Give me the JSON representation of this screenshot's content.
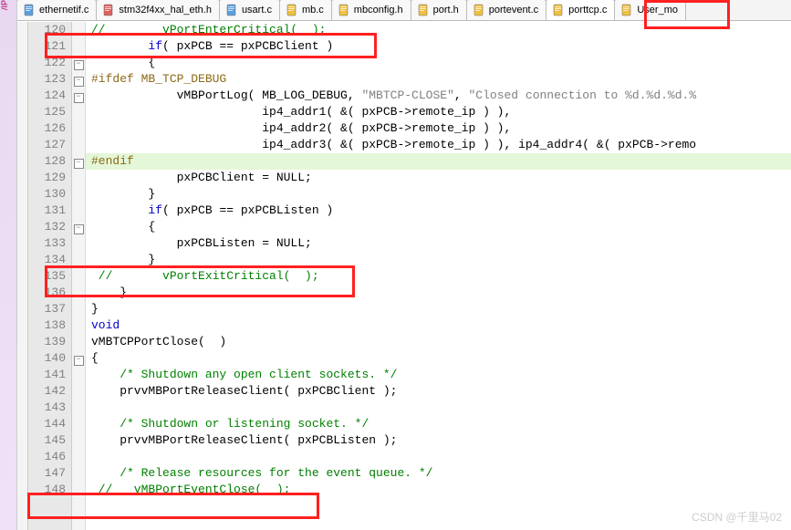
{
  "leftStrip": {
    "label": "/IP"
  },
  "tabs": [
    {
      "label": "ethernetif.c",
      "color": "#5aa0e0",
      "active": false
    },
    {
      "label": "stm32f4xx_hal_eth.h",
      "color": "#e06060",
      "active": false
    },
    {
      "label": "usart.c",
      "color": "#5aa0e0",
      "active": false
    },
    {
      "label": "mb.c",
      "color": "#f0c040",
      "active": false
    },
    {
      "label": "mbconfig.h",
      "color": "#f0c040",
      "active": false
    },
    {
      "label": "port.h",
      "color": "#f0c040",
      "active": false
    },
    {
      "label": "portevent.c",
      "color": "#f0c040",
      "active": false
    },
    {
      "label": "porttcp.c",
      "color": "#f0c040",
      "active": true
    },
    {
      "label": "User_mo",
      "color": "#f0c040",
      "active": false
    }
  ],
  "code": {
    "start": 120,
    "lines": [
      {
        "fold": "",
        "spans": [
          [
            "c-comment",
            "//        vPortEnterCritical(  );"
          ]
        ]
      },
      {
        "fold": "",
        "spans": [
          [
            "c-ident",
            "        "
          ],
          [
            "c-kw",
            "if"
          ],
          [
            "c-ident",
            "( pxPCB == pxPCBClient )"
          ]
        ]
      },
      {
        "fold": "-",
        "spans": [
          [
            "c-ident",
            "        {"
          ]
        ]
      },
      {
        "fold": "-",
        "spans": [
          [
            "c-pre",
            "#ifdef MB_TCP_DEBUG"
          ]
        ]
      },
      {
        "fold": "-",
        "spans": [
          [
            "c-ident",
            "            vMBPortLog( MB_LOG_DEBUG, "
          ],
          [
            "c-str",
            "\"MBTCP-CLOSE\""
          ],
          [
            "c-ident",
            ", "
          ],
          [
            "c-str",
            "\"Closed connection to %d.%d.%d.%"
          ]
        ]
      },
      {
        "fold": "",
        "spans": [
          [
            "c-ident",
            "                        ip4_addr1( &( pxPCB->remote_ip ) ),"
          ]
        ]
      },
      {
        "fold": "",
        "spans": [
          [
            "c-ident",
            "                        ip4_addr2( &( pxPCB->remote_ip ) ),"
          ]
        ]
      },
      {
        "fold": "",
        "spans": [
          [
            "c-ident",
            "                        ip4_addr3( &( pxPCB->remote_ip ) ), ip4_addr4( &( pxPCB->remo"
          ]
        ]
      },
      {
        "fold": "-",
        "hl": "endif",
        "spans": [
          [
            "c-pre",
            "#endif"
          ]
        ]
      },
      {
        "fold": "",
        "spans": [
          [
            "c-ident",
            "            pxPCBClient = NULL;"
          ]
        ]
      },
      {
        "fold": "",
        "spans": [
          [
            "c-ident",
            "        }"
          ]
        ]
      },
      {
        "fold": "",
        "spans": [
          [
            "c-ident",
            "        "
          ],
          [
            "c-kw",
            "if"
          ],
          [
            "c-ident",
            "( pxPCB == pxPCBListen )"
          ]
        ]
      },
      {
        "fold": "-",
        "spans": [
          [
            "c-ident",
            "        {"
          ]
        ]
      },
      {
        "fold": "",
        "spans": [
          [
            "c-ident",
            "            pxPCBListen = NULL;"
          ]
        ]
      },
      {
        "fold": "",
        "spans": [
          [
            "c-ident",
            "        }"
          ]
        ]
      },
      {
        "fold": "",
        "spans": [
          [
            "c-comment",
            " //       vPortExitCritical(  );"
          ]
        ]
      },
      {
        "fold": "",
        "spans": [
          [
            "c-ident",
            "    }"
          ]
        ]
      },
      {
        "fold": "",
        "spans": [
          [
            "c-ident",
            "}"
          ]
        ]
      },
      {
        "fold": "",
        "spans": [
          [
            "c-kw",
            "void"
          ]
        ]
      },
      {
        "fold": "",
        "spans": [
          [
            "c-ident",
            "vMBTCPPortClose(  )"
          ]
        ]
      },
      {
        "fold": "-",
        "spans": [
          [
            "c-ident",
            "{"
          ]
        ]
      },
      {
        "fold": "",
        "spans": [
          [
            "c-comment",
            "    /* Shutdown any open client sockets. */"
          ]
        ]
      },
      {
        "fold": "",
        "spans": [
          [
            "c-ident",
            "    prvvMBPortReleaseClient( pxPCBClient );"
          ]
        ]
      },
      {
        "fold": "",
        "spans": [
          [
            "c-ident",
            ""
          ]
        ]
      },
      {
        "fold": "",
        "spans": [
          [
            "c-comment",
            "    /* Shutdown or listening socket. */"
          ]
        ]
      },
      {
        "fold": "",
        "spans": [
          [
            "c-ident",
            "    prvvMBPortReleaseClient( pxPCBListen );"
          ]
        ]
      },
      {
        "fold": "",
        "spans": [
          [
            "c-ident",
            ""
          ]
        ]
      },
      {
        "fold": "",
        "spans": [
          [
            "c-comment",
            "    /* Release resources for the event queue. */"
          ]
        ]
      },
      {
        "fold": "",
        "spans": [
          [
            "c-comment",
            " //   vMBPortEventClose(  );"
          ]
        ]
      }
    ]
  },
  "watermark": "CSDN @千里马02"
}
